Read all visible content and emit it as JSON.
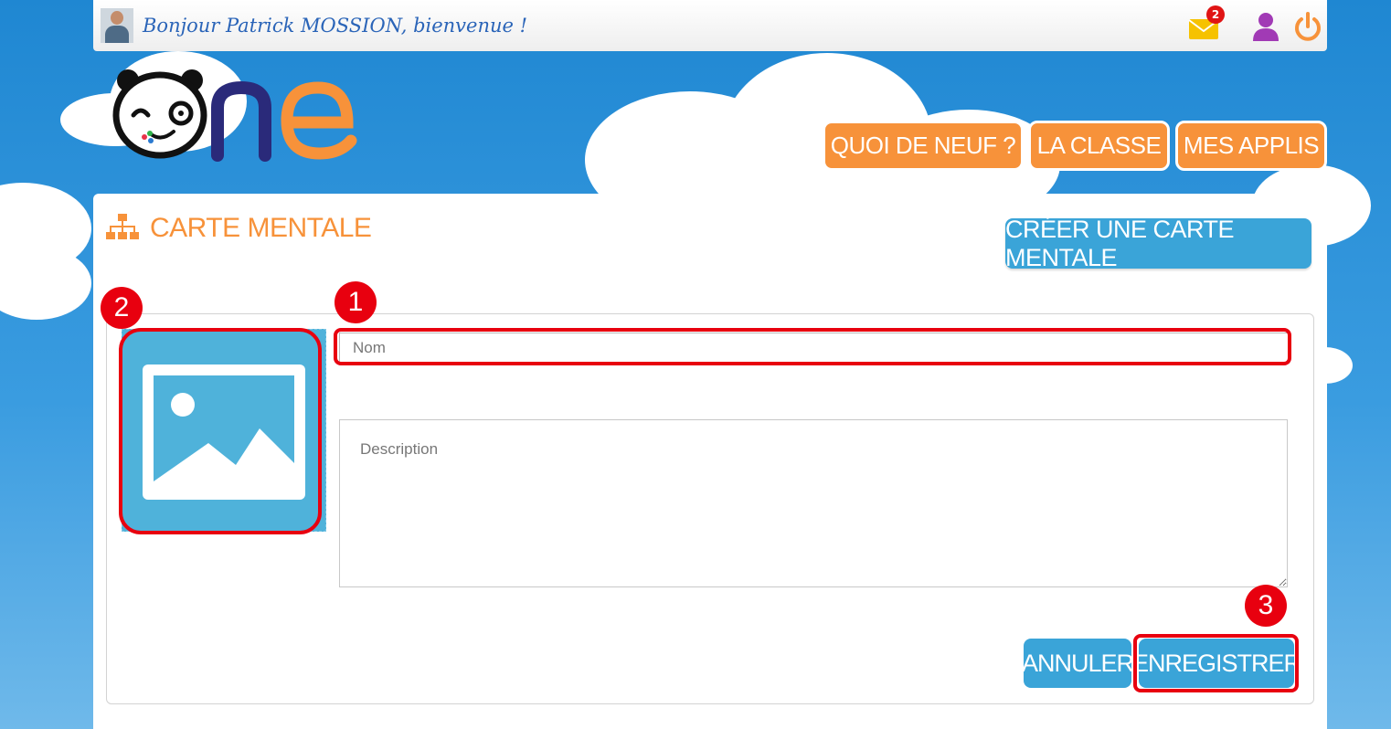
{
  "header": {
    "greeting": "Bonjour Patrick MOSSION, bienvenue !",
    "mail_badge_count": "2"
  },
  "nav": {
    "items": [
      {
        "label": "QUOI DE NEUF ?"
      },
      {
        "label": "LA CLASSE"
      },
      {
        "label": "MES APPLIS"
      }
    ]
  },
  "page": {
    "title": "CARTE MENTALE",
    "create_button": "CRÉER UNE CARTE MENTALE"
  },
  "form": {
    "name_placeholder": "Nom",
    "name_value": "",
    "description_placeholder": "Description",
    "description_value": "",
    "cancel_label": "ANNULER",
    "save_label": "ENREGISTRER"
  },
  "annotations": {
    "markers": [
      "1",
      "2",
      "3"
    ],
    "color": "#e8000f"
  },
  "colors": {
    "accent_orange": "#f7923a",
    "accent_blue": "#3aa4d8",
    "background_blue": "#1f87d2"
  }
}
